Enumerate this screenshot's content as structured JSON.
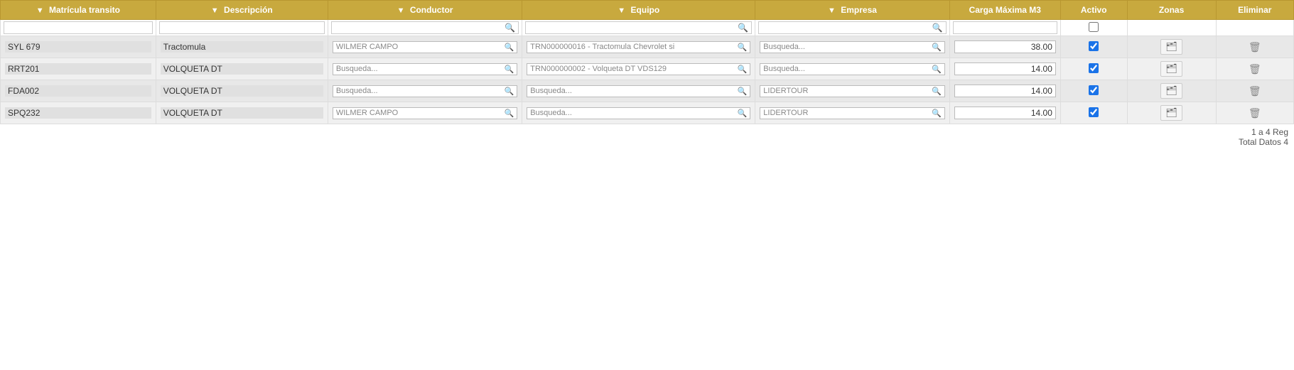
{
  "columns": {
    "matricula": "Matrícula transito",
    "descripcion": "Descripción",
    "conductor": "Conductor",
    "equipo": "Equipo",
    "empresa": "Empresa",
    "carga": "Carga Máxima M3",
    "activo": "Activo",
    "zonas": "Zonas",
    "eliminar": "Eliminar"
  },
  "filter_placeholders": {
    "matricula": "",
    "descripcion": "",
    "conductor": "",
    "equipo": "",
    "empresa": "",
    "carga": ""
  },
  "rows": [
    {
      "matricula": "SYL 679",
      "descripcion": "Tractomula",
      "conductor": "WILMER  CAMPO",
      "conductor_search": true,
      "equipo": "TRN000000016 - Tractomula Chevrolet si",
      "equipo_search": true,
      "empresa": "Busqueda...",
      "empresa_search": true,
      "carga": "38.00",
      "activo": true,
      "has_zonas": true,
      "has_eliminar": true
    },
    {
      "matricula": "RRT201",
      "descripcion": "VOLQUETA DT",
      "conductor": "Busqueda...",
      "conductor_search": true,
      "equipo": "TRN000000002 - Volqueta DT VDS129",
      "equipo_search": true,
      "empresa": "Busqueda...",
      "empresa_search": true,
      "carga": "14.00",
      "activo": true,
      "has_zonas": true,
      "has_eliminar": true
    },
    {
      "matricula": "FDA002",
      "descripcion": "VOLQUETA DT",
      "conductor": "Busqueda...",
      "conductor_search": true,
      "equipo": "Busqueda...",
      "equipo_search": true,
      "empresa": "LIDERTOUR",
      "empresa_search": true,
      "carga": "14.00",
      "activo": true,
      "has_zonas": true,
      "has_eliminar": true
    },
    {
      "matricula": "SPQ232",
      "descripcion": "VOLQUETA DT",
      "conductor": "WILMER  CAMPO",
      "conductor_search": true,
      "equipo": "Busqueda...",
      "equipo_search": true,
      "empresa": "LIDERTOUR",
      "empresa_search": true,
      "carga": "14.00",
      "activo": true,
      "has_zonas": true,
      "has_eliminar": true
    }
  ],
  "pagination": {
    "range": "1 a 4 Reg",
    "total": "Total Datos 4"
  },
  "icons": {
    "filter": "▼",
    "search": "🔍",
    "checkbox_empty": "☐",
    "zonas": "📋",
    "trash": "🗑"
  }
}
